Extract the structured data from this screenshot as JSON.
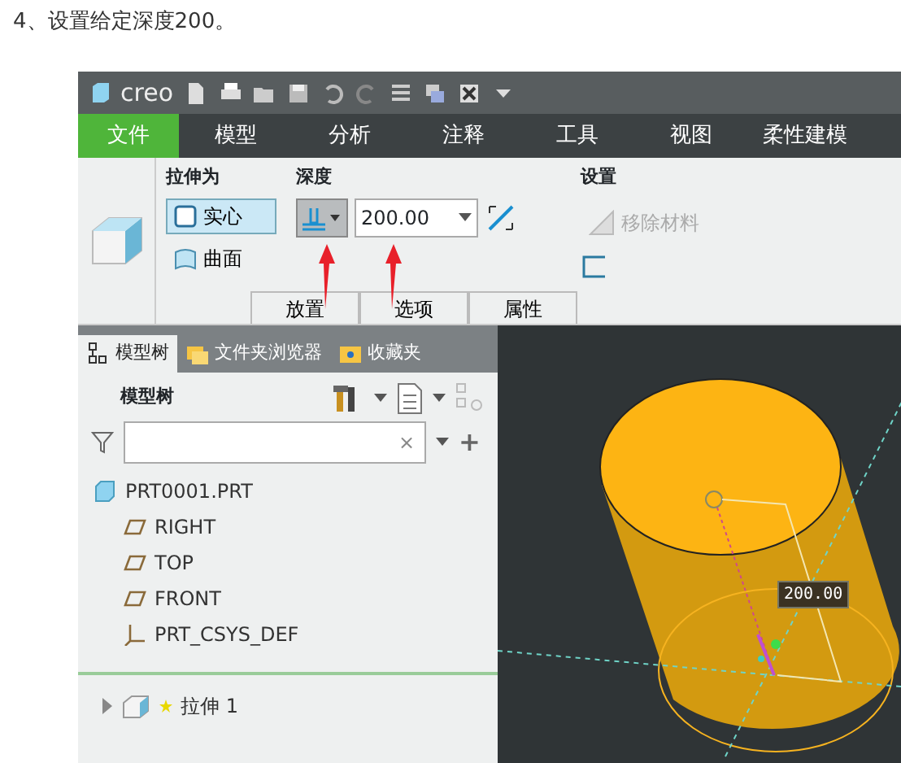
{
  "heading": "4、设置给定深度200。",
  "app": {
    "logo": "creo"
  },
  "menu_tabs": [
    {
      "label": "文件",
      "selected": true
    },
    {
      "label": "模型",
      "selected": false
    },
    {
      "label": "分析",
      "selected": false
    },
    {
      "label": "注释",
      "selected": false
    },
    {
      "label": "工具",
      "selected": false
    },
    {
      "label": "视图",
      "selected": false
    },
    {
      "label": "柔性建模",
      "selected": false
    }
  ],
  "ribbon": {
    "extrude_as": {
      "title": "拉伸为",
      "options": [
        {
          "label": "实心",
          "selected": true
        },
        {
          "label": "曲面",
          "selected": false
        }
      ]
    },
    "depth": {
      "title": "深度",
      "blind_selected": true,
      "value": "200.00"
    },
    "settings": {
      "title": "设置",
      "remove_material": {
        "label": "移除材料",
        "disabled": true
      }
    },
    "panel_tabs": [
      "放置",
      "选项",
      "属性"
    ]
  },
  "left_tabs": [
    {
      "label": "模型树",
      "selected": true
    },
    {
      "label": "文件夹浏览器",
      "selected": false
    },
    {
      "label": "收藏夹",
      "selected": false
    }
  ],
  "tree_title": "模型树",
  "filter": {
    "clear": "×",
    "add": "+"
  },
  "tree": [
    {
      "kind": "part",
      "label": "PRT0001.PRT",
      "children": [
        {
          "kind": "plane",
          "label": "RIGHT"
        },
        {
          "kind": "plane",
          "label": "TOP"
        },
        {
          "kind": "plane",
          "label": "FRONT"
        },
        {
          "kind": "csys",
          "label": "PRT_CSYS_DEF"
        }
      ]
    }
  ],
  "features": [
    {
      "label": "拉伸 1",
      "expanded": false
    }
  ],
  "viewport": {
    "dimension": "200.00"
  }
}
